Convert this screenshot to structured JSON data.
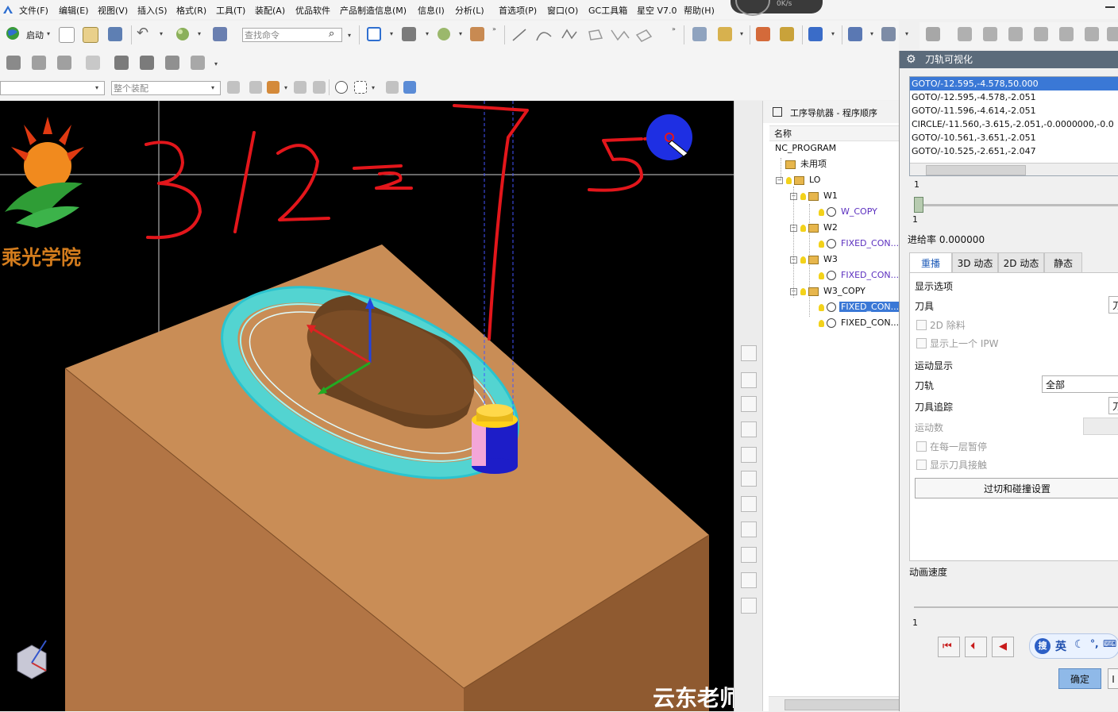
{
  "menu": [
    "文件(F)",
    "编辑(E)",
    "视图(V)",
    "插入(S)",
    "格式(R)",
    "工具(T)",
    "装配(A)",
    "优品软件",
    "产品制造信息(M)",
    "信息(I)",
    "分析(L)",
    "首选项(P)",
    "窗口(O)",
    "GC工具箱",
    "星空 V7.0",
    "帮助(H)"
  ],
  "status_gauge": "0K/s",
  "toolbar": {
    "start_label": "启动",
    "search_command_placeholder": "查找命令",
    "filter_value": "",
    "assembly_scope": "整个装配"
  },
  "viewport": {
    "logo_text": "乘光学院",
    "watermark": "云东老师",
    "handwriting": "3 1 2 - 2   7 5"
  },
  "navigator": {
    "title": "工序导航器 - 程序顺序",
    "column_name": "名称",
    "tree": [
      {
        "label": "NC_PROGRAM",
        "level": 0,
        "kind": "root"
      },
      {
        "label": "未用项",
        "level": 1,
        "kind": "group"
      },
      {
        "label": "LO",
        "level": 1,
        "kind": "group"
      },
      {
        "label": "W1",
        "level": 2,
        "kind": "group"
      },
      {
        "label": "W_COPY",
        "level": 3,
        "kind": "op"
      },
      {
        "label": "W2",
        "level": 2,
        "kind": "group"
      },
      {
        "label": "FIXED_CON...",
        "level": 3,
        "kind": "op"
      },
      {
        "label": "W3",
        "level": 2,
        "kind": "group"
      },
      {
        "label": "FIXED_CON...",
        "level": 3,
        "kind": "op"
      },
      {
        "label": "W3_COPY",
        "level": 2,
        "kind": "group"
      },
      {
        "label": "FIXED_CON...",
        "level": 3,
        "kind": "op",
        "selected": true
      },
      {
        "label": "FIXED_CON...",
        "level": 3,
        "kind": "op"
      }
    ]
  },
  "dialog": {
    "title": "刀轨可视化",
    "toolpath_lines": [
      "GOTO/-12.595,-4.578,50.000",
      "GOTO/-12.595,-4.578,-2.051",
      "GOTO/-11.596,-4.614,-2.051",
      "CIRCLE/-11.560,-3.615,-2.051,-0.0000000,-0.0",
      "GOTO/-10.561,-3.651,-2.051",
      "GOTO/-10.525,-2.651,-2.047"
    ],
    "selected_line": 0,
    "slider_top_value": "1",
    "slider_bottom_value": "1",
    "feedrate_label": "进给率 0.000000",
    "tabs": [
      "重播",
      "3D 动态",
      "2D 动态",
      "静态"
    ],
    "active_tab": 0,
    "display_options_label": "显示选项",
    "tool_label": "刀具",
    "tool_value": "刀",
    "remove_2d_label": "2D 除料",
    "show_prev_ipw_label": "显示上一个 IPW",
    "motion_display_label": "运动显示",
    "toolpath_label": "刀轨",
    "toolpath_value": "全部",
    "tool_trace_label": "刀具追踪",
    "tool_trace_value": "刀",
    "motion_count_label": "运动数",
    "pause_each_layer_label": "在每一层暂停",
    "show_tool_contact_label": "显示刀具接触",
    "gouge_button": "过切和碰撞设置",
    "anim_speed_label": "动画速度",
    "anim_speed_value": "1",
    "ok_button": "确定",
    "cancel_button": "I"
  },
  "ime": {
    "logo": "搜",
    "lang": "英"
  },
  "colors": {
    "block_top": "#c98d56",
    "block_left": "#b27545",
    "block_front": "#8f5a30",
    "toolpath": "#3ee0e6",
    "island": "#6a4321",
    "annotation": "#e3161b",
    "selection": "#3a78d6"
  }
}
